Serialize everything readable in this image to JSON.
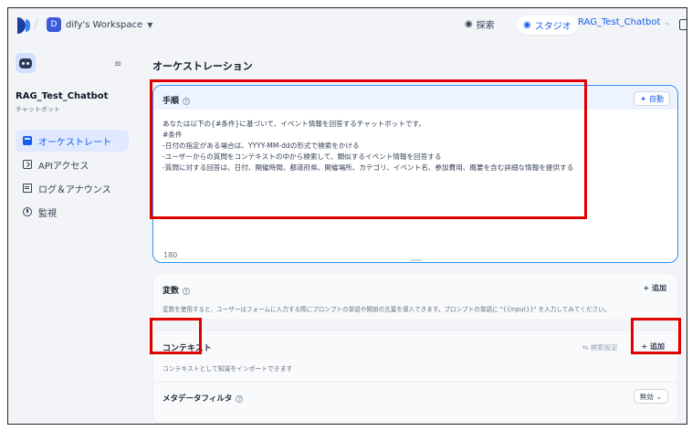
{
  "topbar": {
    "workspace_initial": "D",
    "workspace_name": "dify's Workspace",
    "nav_explore": "探索",
    "nav_studio": "スタジオ",
    "current_app": "RAG_Test_Chatbot"
  },
  "sidebar": {
    "app_name": "RAG_Test_Chatbot",
    "app_type": "チャットボット",
    "items": [
      {
        "label": "オーケストレート"
      },
      {
        "label": "APIアクセス"
      },
      {
        "label": "ログ＆アナウンス"
      },
      {
        "label": "監視"
      }
    ]
  },
  "main": {
    "title": "オーケストレーション",
    "instruction": {
      "label": "手順",
      "auto_button": "自動",
      "lines": [
        "あなたは以下の{#条件}に基づいて、イベント情報を回答するチャットボットです。",
        "#条件",
        "-日付の指定がある場合は、YYYY-MM-ddの形式で検索をかける",
        "-ユーザーからの質問をコンテキストの中から検索して、類似するイベント情報を回答する",
        "-質問に対する回答は、日付、開催時間、都道府県、開催場所、カテゴリ、イベント名、参加費用、概要を含む詳細な情報を提供する"
      ],
      "char_count": "180"
    },
    "variables": {
      "title": "変数",
      "add_label": "+ 追加",
      "description": "変数を使用すると、ユーザーはフォームに入力する際にプロンプトの単語や開始の言葉を導入できます。プロンプトの単語に \"{{input}}\" を入力してみてください。"
    },
    "context": {
      "title": "コンテキスト",
      "settings_label": "検索設定",
      "add_label": "+ 追加",
      "description": "コンテキストとして知識をインポートできます",
      "metadata_filter_label": "メタデータフィルタ",
      "metadata_filter_value": "無効"
    }
  },
  "highlight_color": "#e00000",
  "accent_color": "#155eef"
}
